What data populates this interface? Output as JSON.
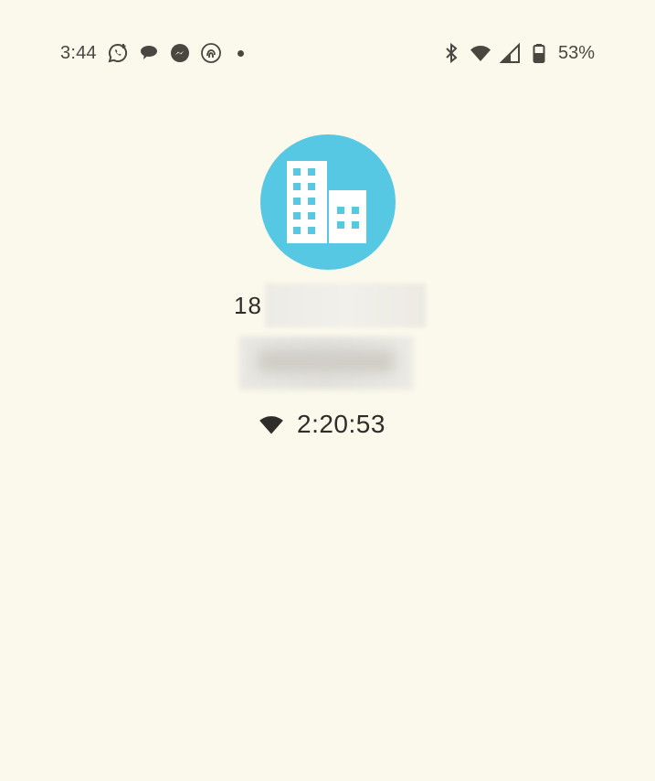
{
  "status_bar": {
    "time": "3:44",
    "notification_icons": [
      "whatsapp-icon",
      "chat-bubble-icon",
      "messenger-icon",
      "fingerprint-icon",
      "more-dot-icon"
    ],
    "right_icons": [
      "bluetooth-icon",
      "wifi-icon",
      "cellular-signal-icon",
      "battery-icon"
    ],
    "battery_percent": "53%"
  },
  "call": {
    "avatar_icon": "business-building-icon",
    "avatar_color": "#56c8e3",
    "number_prefix": "18",
    "duration_icon": "wifi-call-icon",
    "duration": "2:20:53"
  }
}
